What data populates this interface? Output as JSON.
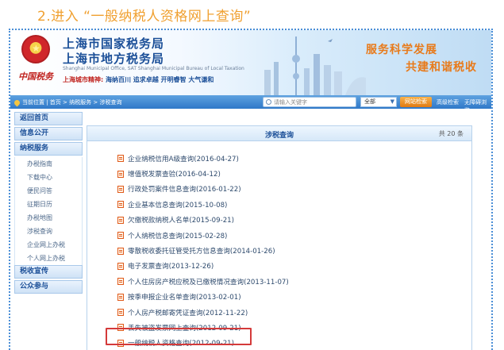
{
  "caption": "2.进入 “一般纳税人资格网上查询”",
  "header": {
    "title_state": "上海市国家税务局",
    "title_local": "上海市地方税务局",
    "title_en": "Shanghai Municipal Office, SAT  Shanghai Municipal Bureau of Local Taxation",
    "spirit_label": "上海城市精神:",
    "spirit_text": "海纳百川  追求卓越  开明睿智  大气谦和",
    "calligraphy": "中国税务",
    "slogan_line1": "服务科学发展",
    "slogan_line2": "共建和谐税收"
  },
  "navbar": {
    "breadcrumb": "当前位置 | 首页 > 纳税服务 > 涉税查询",
    "search_placeholder": "请输入关键字",
    "scope_value": "全部",
    "search_button": "网站检索",
    "advanced_search": "高级检索",
    "accessibility": "无障碍浏览"
  },
  "sidebar": {
    "home": "返回首页",
    "info": "信息公开",
    "service": "纳税服务",
    "sub": [
      "办税指南",
      "下载中心",
      "便民问答",
      "征期日历",
      "办税地图",
      "涉税查询",
      "企业网上办税",
      "个人网上办税"
    ],
    "promo": "税收宣传",
    "public": "公众参与"
  },
  "panel": {
    "title": "涉税查询",
    "count": "共 20 条",
    "items": [
      "企业纳税信用A级查询(2016-04-27)",
      "增值税发票查验(2016-04-12)",
      "行政处罚案件信息查询(2016-01-22)",
      "企业基本信息查询(2015-10-08)",
      "欠缴税款纳税人名单(2015-09-21)",
      "个人纳税信息查询(2015-02-28)",
      "零散税收委托征管受托方信息查询(2014-01-26)",
      "电子发票查询(2013-12-26)",
      "个人住房房产税应税及已缴税情况查询(2013-11-07)",
      "按季申报企业名单查询(2013-02-01)",
      "个人房产税邮寄凭证查询(2012-11-22)",
      "丢失被盗发票网上查询(2012-09-21)",
      "一般纳税人资格查询(2012-09-21)"
    ]
  },
  "colors": {
    "caption": "#f0a030",
    "nav_blue": "#2f78c8",
    "title_blue": "#1b4f98",
    "slogan_orange": "#e87a1a",
    "highlight_red": "#d43a3a"
  }
}
